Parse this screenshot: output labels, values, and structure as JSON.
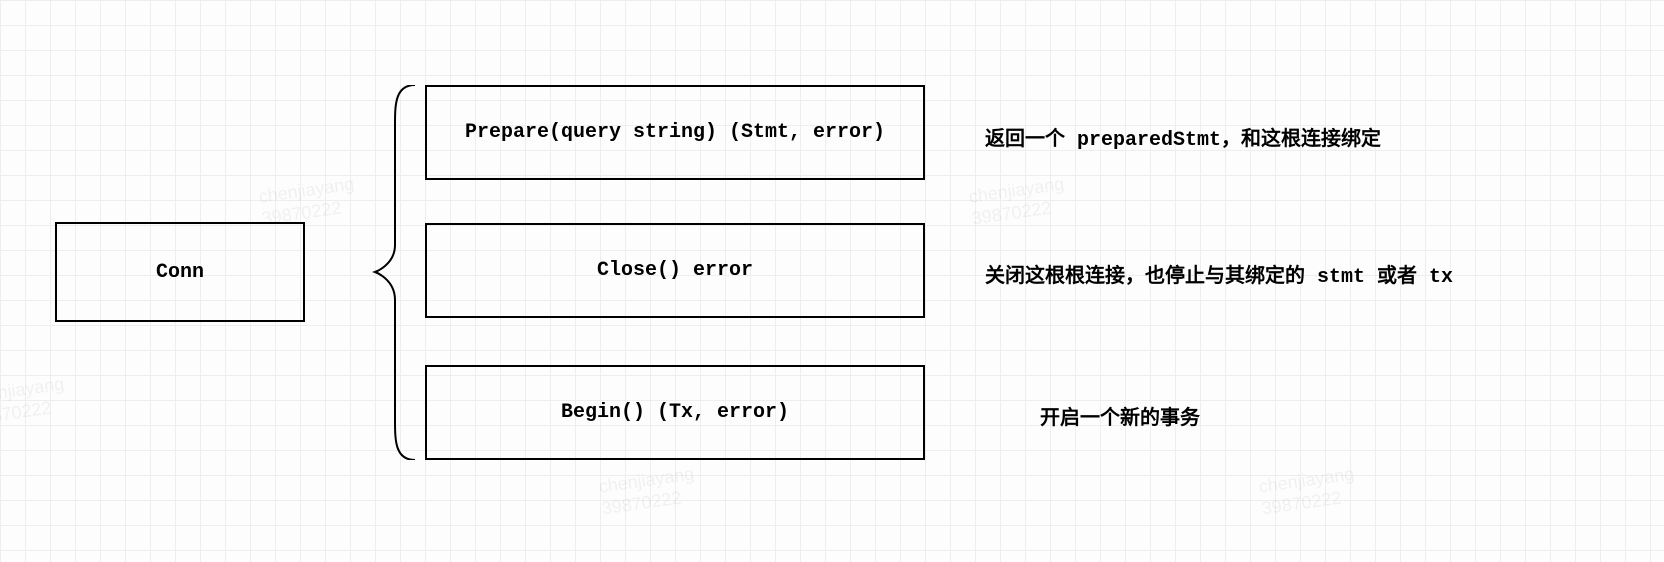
{
  "root": {
    "label": "Conn"
  },
  "methods": [
    {
      "signature": "Prepare(query string) (Stmt, error)",
      "desc_parts": [
        "返回一个 ",
        "preparedStmt",
        "，和这根连接绑定"
      ]
    },
    {
      "signature": "Close() error",
      "desc_parts": [
        "关闭这根根连接，也停止与其绑定的 ",
        "stmt",
        " 或者 ",
        "tx"
      ]
    },
    {
      "signature": "Begin() (Tx, error)",
      "desc_parts": [
        "开启一个新的事务"
      ]
    }
  ],
  "watermark": {
    "line1": "chenjiayang",
    "line2": "39870222"
  }
}
